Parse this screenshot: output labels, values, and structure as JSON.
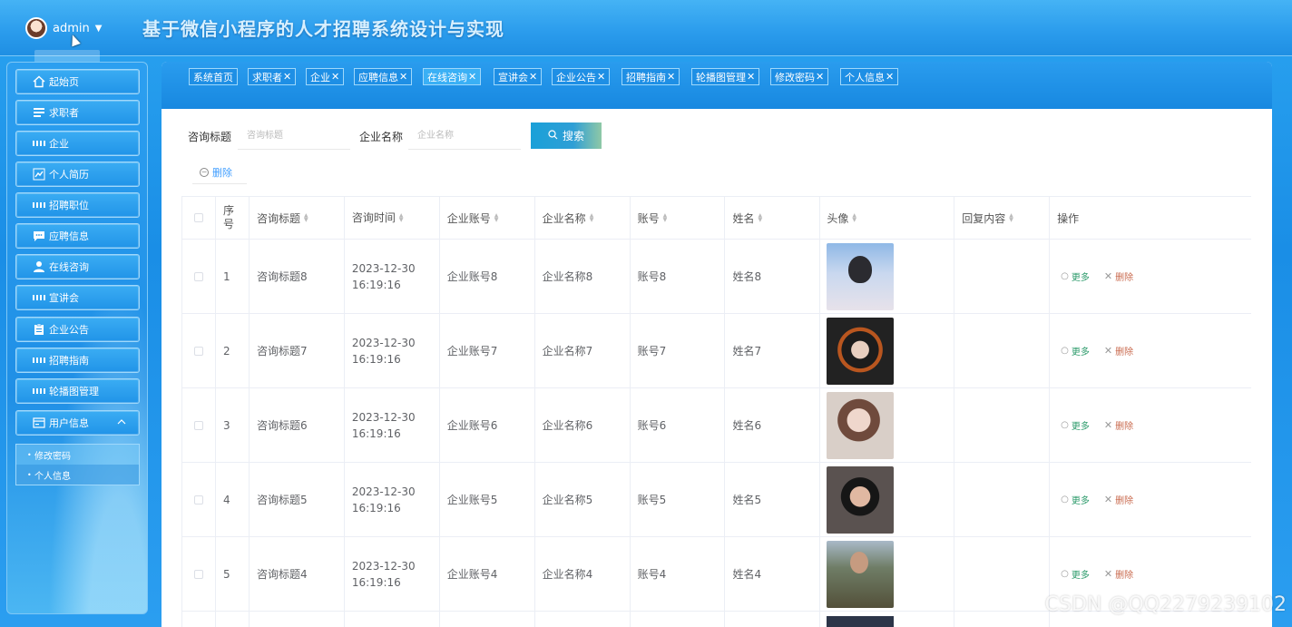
{
  "header": {
    "user_name": "admin",
    "app_title": "基于微信小程序的人才招聘系统设计与实现"
  },
  "sidebar": {
    "items": [
      {
        "label": "起始页",
        "icon": "home-icon"
      },
      {
        "label": "求职者",
        "icon": "list-icon"
      },
      {
        "label": "企业",
        "icon": "grid-icon"
      },
      {
        "label": "个人简历",
        "icon": "chart-icon"
      },
      {
        "label": "招聘职位",
        "icon": "grid-icon"
      },
      {
        "label": "应聘信息",
        "icon": "chat-icon"
      },
      {
        "label": "在线咨询",
        "icon": "user-icon"
      },
      {
        "label": "宣讲会",
        "icon": "grid-icon"
      },
      {
        "label": "企业公告",
        "icon": "clipboard-icon"
      },
      {
        "label": "招聘指南",
        "icon": "grid-icon"
      },
      {
        "label": "轮播图管理",
        "icon": "grid-icon"
      },
      {
        "label": "用户信息",
        "icon": "card-icon"
      }
    ],
    "submenu": [
      "修改密码",
      "个人信息"
    ]
  },
  "tabs": [
    {
      "label": "系统首页",
      "closable": false
    },
    {
      "label": "求职者",
      "closable": true
    },
    {
      "label": "企业",
      "closable": true
    },
    {
      "label": "应聘信息",
      "closable": true
    },
    {
      "label": "在线咨询",
      "closable": true,
      "active": true
    },
    {
      "label": "宣讲会",
      "closable": true
    },
    {
      "label": "企业公告",
      "closable": true
    },
    {
      "label": "招聘指南",
      "closable": true
    },
    {
      "label": "轮播图管理",
      "closable": true
    },
    {
      "label": "修改密码",
      "closable": true
    },
    {
      "label": "个人信息",
      "closable": true
    }
  ],
  "search": {
    "title_label": "咨询标题",
    "title_placeholder": "咨询标题",
    "company_label": "企业名称",
    "company_placeholder": "企业名称",
    "search_button": "搜索",
    "delete_button": "删除"
  },
  "table": {
    "headers": [
      "序号",
      "咨询标题",
      "咨询时间",
      "企业账号",
      "企业名称",
      "账号",
      "姓名",
      "头像",
      "回复内容",
      "操作"
    ],
    "rows": [
      {
        "index": "1",
        "title": "咨询标题8",
        "time": "2023-12-30 16:19:16",
        "company_account": "企业账号8",
        "company_name": "企业名称8",
        "account": "账号8",
        "name": "姓名8",
        "reply": ""
      },
      {
        "index": "2",
        "title": "咨询标题7",
        "time": "2023-12-30 16:19:16",
        "company_account": "企业账号7",
        "company_name": "企业名称7",
        "account": "账号7",
        "name": "姓名7",
        "reply": ""
      },
      {
        "index": "3",
        "title": "咨询标题6",
        "time": "2023-12-30 16:19:16",
        "company_account": "企业账号6",
        "company_name": "企业名称6",
        "account": "账号6",
        "name": "姓名6",
        "reply": ""
      },
      {
        "index": "4",
        "title": "咨询标题5",
        "time": "2023-12-30 16:19:16",
        "company_account": "企业账号5",
        "company_name": "企业名称5",
        "account": "账号5",
        "name": "姓名5",
        "reply": ""
      },
      {
        "index": "5",
        "title": "咨询标题4",
        "time": "2023-12-30 16:19:16",
        "company_account": "企业账号4",
        "company_name": "企业名称4",
        "account": "账号4",
        "name": "姓名4",
        "reply": ""
      }
    ],
    "more_label": "更多",
    "delete_label": "删除"
  },
  "watermark": "CSDN @QQ2279239102"
}
